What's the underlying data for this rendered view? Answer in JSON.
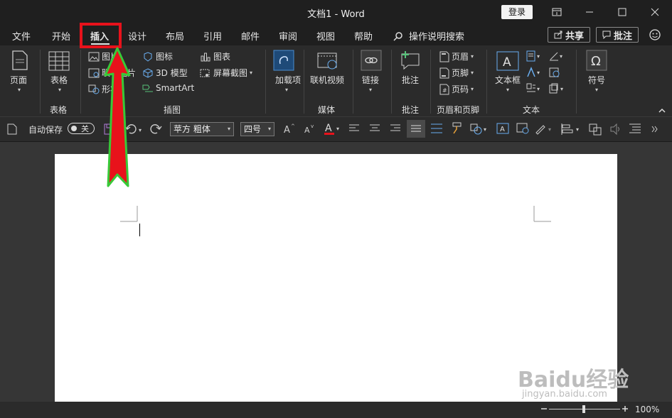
{
  "window": {
    "title": "文档1  -  Word",
    "login_label": "登录",
    "buttons": [
      "ribbon-display",
      "minimize",
      "maximize",
      "close"
    ]
  },
  "tabs": [
    "文件",
    "开始",
    "插入",
    "设计",
    "布局",
    "引用",
    "邮件",
    "审阅",
    "视图",
    "帮助"
  ],
  "search": {
    "label": "操作说明搜索"
  },
  "share_label": "共享",
  "comments_label": "批注",
  "ribbon": {
    "groups": {
      "pages": {
        "button": "页面",
        "group_label": ""
      },
      "tables": {
        "button": "表格",
        "group_label": "表格"
      },
      "illustrations": {
        "group_label": "插图",
        "items": [
          "图片",
          "联机图片",
          "形状",
          "图标",
          "3D 模型",
          "SmartArt",
          "图表",
          "屏幕截图"
        ]
      },
      "addins": {
        "button": "加载项",
        "group_label": ""
      },
      "media": {
        "button": "联机视频",
        "group_label": "媒体"
      },
      "links": {
        "button": "链接",
        "group_label": ""
      },
      "comments": {
        "button": "批注",
        "group_label": "批注"
      },
      "header_footer": {
        "items": [
          "页眉",
          "页脚",
          "页码"
        ],
        "group_label": "页眉和页脚"
      },
      "text": {
        "button": "文本框",
        "group_label": "文本"
      },
      "symbols": {
        "button": "符号",
        "group_label": ""
      }
    }
  },
  "qat": {
    "autosave_label": "自动保存",
    "autosave_state": "关",
    "font_name": "苹方 粗体",
    "font_size": "四号"
  },
  "status": {
    "zoom": "100%"
  },
  "watermark": {
    "line1": "Baidu经验",
    "line2": "jingyan.baidu.com"
  },
  "colors": {
    "highlight": "#e8121b",
    "arrow_fill": "#e8121b",
    "arrow_outline": "#38c938"
  }
}
